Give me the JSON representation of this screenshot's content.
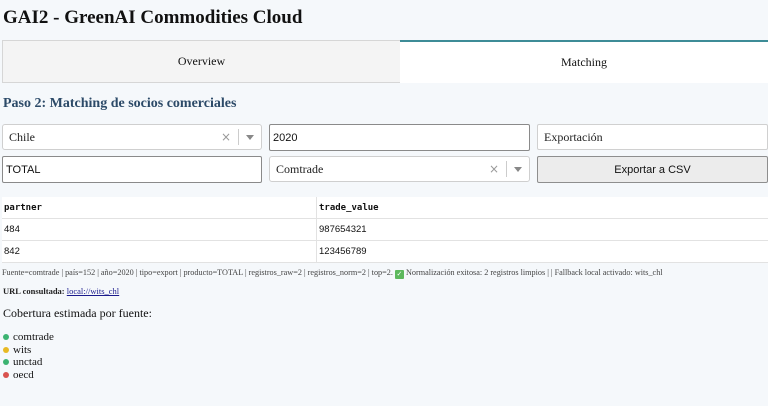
{
  "app": {
    "title": "GAI2 - GreenAI Commodities Cloud"
  },
  "tabs": [
    {
      "label": "Overview"
    },
    {
      "label": "Matching"
    }
  ],
  "step": {
    "title": "Paso 2: Matching de socios comerciales"
  },
  "filters": {
    "country": "Chile",
    "year": "2020",
    "flow": "Exportación",
    "product": "TOTAL",
    "source": "Comtrade",
    "export_button": "Exportar a CSV"
  },
  "table": {
    "headers": [
      "partner",
      "trade_value"
    ],
    "rows": [
      [
        "484",
        "987654321"
      ],
      [
        "842",
        "123456789"
      ]
    ]
  },
  "status": {
    "meta": "Fuente=comtrade | país=152 | año=2020 | tipo=export | producto=TOTAL | registros_raw=2 | registros_norm=2 | top=2.",
    "success": "Normalización exitosa: 2 registros limpios | | Fallback local activado: wits_chl"
  },
  "url": {
    "label": "URL consultada:",
    "link": "local://wits_chl"
  },
  "coverage": {
    "title": "Cobertura estimada por fuente:",
    "sources": [
      {
        "name": "comtrade",
        "color": "#3cb371"
      },
      {
        "name": "wits",
        "color": "#e8b923"
      },
      {
        "name": "unctad",
        "color": "#3cb371"
      },
      {
        "name": "oecd",
        "color": "#d9534f"
      }
    ]
  },
  "colors": {
    "accent": "#3d8c97",
    "step_title": "#2c4a68"
  }
}
